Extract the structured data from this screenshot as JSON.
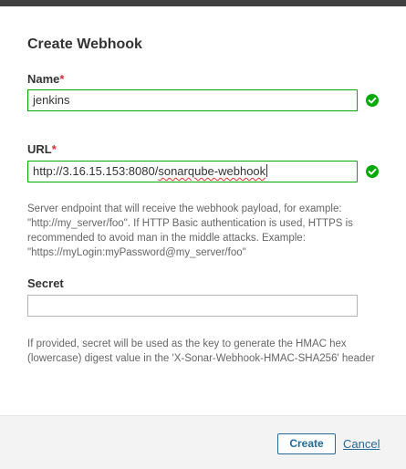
{
  "dialog": {
    "title": "Create Webhook"
  },
  "name_field": {
    "label": "Name",
    "required_mark": "*",
    "value": "jenkins"
  },
  "url_field": {
    "label": "URL",
    "required_mark": "*",
    "value_plain": "http://3.16.15.153:8080/",
    "value_spellmarked": "sonarqube-webhook",
    "help": "Server endpoint that will receive the webhook payload, for example: \"http://my_server/foo\". If HTTP Basic authentication is used, HTTPS is recommended to avoid man in the middle attacks. Example: \"https://myLogin:myPassword@my_server/foo\""
  },
  "secret_field": {
    "label": "Secret",
    "value": "",
    "help": "If provided, secret will be used as the key to generate the HMAC hex (lowercase) digest value in the 'X-Sonar-Webhook-HMAC-SHA256' header"
  },
  "footer": {
    "create_label": "Create",
    "cancel_label": "Cancel"
  },
  "colors": {
    "valid": "#00aa00",
    "required": "#d02f3a",
    "link": "#236a97"
  },
  "icons": {
    "valid": "check-circle-icon"
  }
}
